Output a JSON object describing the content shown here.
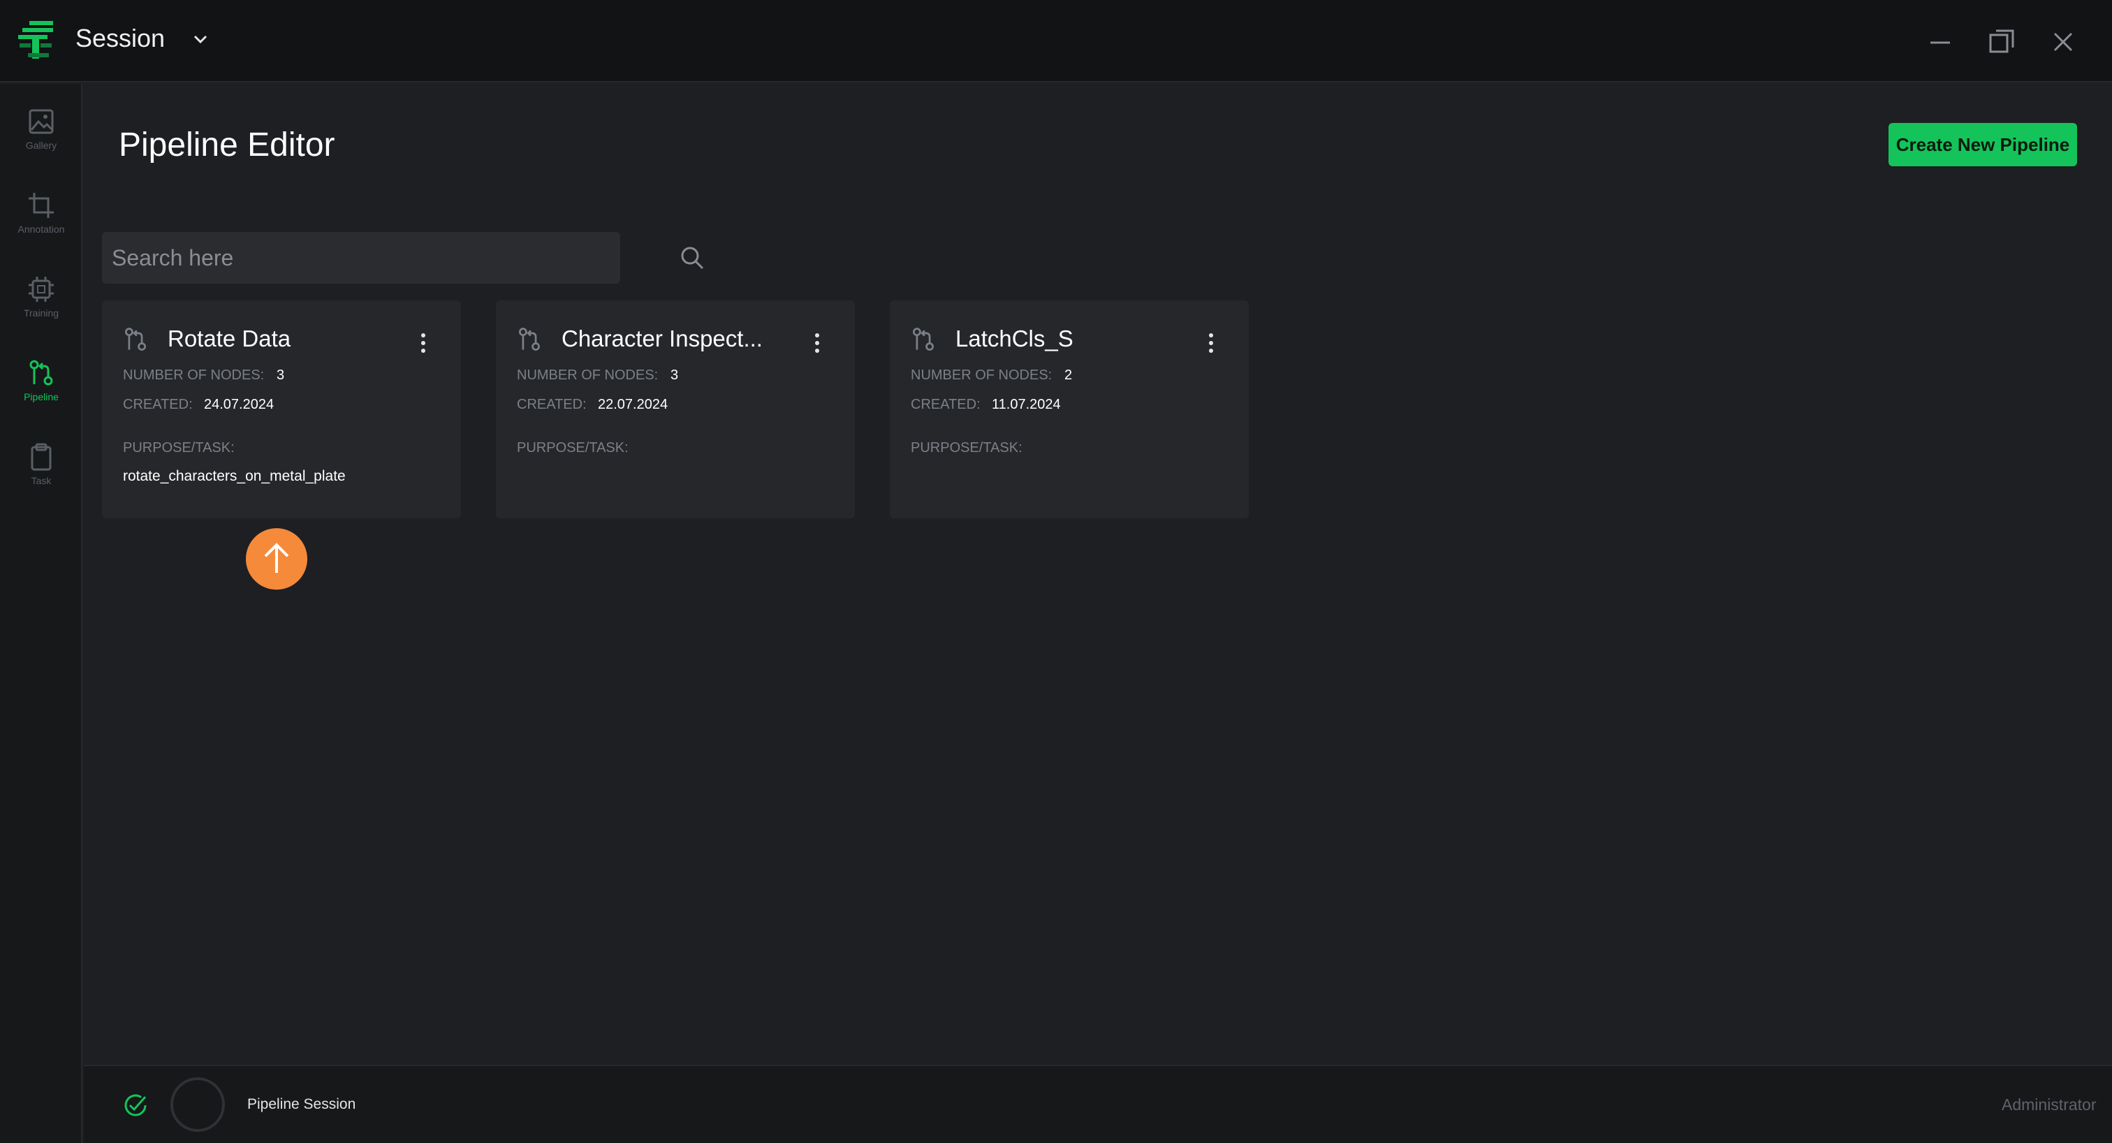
{
  "titlebar": {
    "session_label": "Session"
  },
  "sidebar": {
    "items": [
      {
        "label": "Gallery",
        "icon": "image-icon",
        "active": false
      },
      {
        "label": "Annotation",
        "icon": "crop-icon",
        "active": false
      },
      {
        "label": "Training",
        "icon": "chip-icon",
        "active": false
      },
      {
        "label": "Pipeline",
        "icon": "pipeline-icon",
        "active": true
      },
      {
        "label": "Task",
        "icon": "clipboard-icon",
        "active": false
      }
    ]
  },
  "main": {
    "title": "Pipeline Editor",
    "create_button": "Create New Pipeline",
    "search": {
      "placeholder": "Search here",
      "value": ""
    },
    "labels": {
      "nodes": "NUMBER OF NODES:",
      "created": "CREATED:",
      "purpose": "PURPOSE/TASK:"
    },
    "cards": [
      {
        "title": "Rotate Data",
        "nodes": "3",
        "created": "24.07.2024",
        "purpose": "rotate_characters_on_metal_plate"
      },
      {
        "title": "Character Inspect...",
        "nodes": "3",
        "created": "22.07.2024",
        "purpose": ""
      },
      {
        "title": "LatchCls_S",
        "nodes": "2",
        "created": "11.07.2024",
        "purpose": ""
      }
    ]
  },
  "statusbar": {
    "session": "Pipeline Session",
    "user": "Administrator"
  },
  "colors": {
    "accent": "#14c45a",
    "background": "#1e1f22",
    "card": "#25272a",
    "cursor_badge": "#f58a3b"
  }
}
